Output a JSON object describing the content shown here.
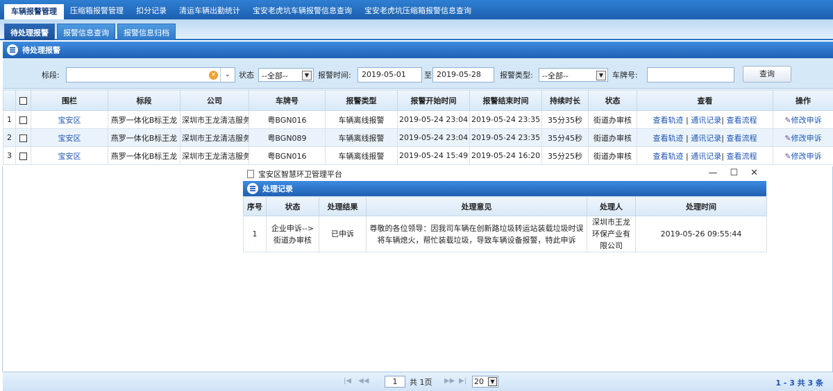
{
  "topnav": {
    "items": [
      "车辆报警管理",
      "压缩箱报警管理",
      "扣分记录",
      "清运车辆出勤统计",
      "宝安老虎坑车辆报警信息查询",
      "宝安老虎坑压缩箱报警信息查询"
    ]
  },
  "subtabs": [
    "待处理报警",
    "报警信息查询",
    "报警信息归档"
  ],
  "panel": {
    "title": "待处理报警"
  },
  "filters": {
    "segment_label": "标段:",
    "segment_value": "",
    "status_label": "状态",
    "status_value": "--全部--",
    "alarm_time_label": "报警时间:",
    "date_from": "2019-05-01",
    "to_label": "至",
    "date_to": "2019-05-28",
    "alarm_type_label": "报警类型:",
    "alarm_type_value": "--全部--",
    "plate_label": "车牌号:",
    "plate_value": "",
    "query_label": "查询"
  },
  "grid": {
    "headers": [
      "围栏",
      "标段",
      "公司",
      "车牌号",
      "报警类型",
      "报警开始时间",
      "报警结束时间",
      "持续时长",
      "状态",
      "查看",
      "操作"
    ],
    "rows": [
      {
        "no": "1",
        "fence": "宝安区",
        "segment": "燕罗一体化B标王龙",
        "company": "深圳市王龙清洁服务有",
        "plate": "粤BGN016",
        "type": "车辆离线报警",
        "start": "2019-05-24 23:04",
        "end": "2019-05-24 23:35",
        "duration": "35分35秒",
        "status": "街道办审核"
      },
      {
        "no": "2",
        "fence": "宝安区",
        "segment": "燕罗一体化B标王龙",
        "company": "深圳市王龙清洁服务有",
        "plate": "粤BGN089",
        "type": "车辆离线报警",
        "start": "2019-05-24 23:04",
        "end": "2019-05-24 23:35",
        "duration": "35分45秒",
        "status": "街道办审核"
      },
      {
        "no": "3",
        "fence": "宝安区",
        "segment": "燕罗一体化B标王龙",
        "company": "深圳市王龙清洁服务有",
        "plate": "粤BGN016",
        "type": "车辆离线报警",
        "start": "2019-05-24 15:49",
        "end": "2019-05-24 16:20",
        "duration": "35分25秒",
        "status": "街道办审核"
      }
    ],
    "view_links": [
      "查看轨迹",
      "通讯记录",
      "查看流程"
    ],
    "action_label": "修改申诉"
  },
  "popup": {
    "window_title": "宝安区智慧环卫管理平台",
    "panel_title": "处理记录",
    "headers": [
      "序号",
      "状态",
      "处理结果",
      "处理意见",
      "处理人",
      "处理时间"
    ],
    "row": {
      "no": "1",
      "status": "企业申诉-->街道办审核",
      "result": "已申诉",
      "opinion": "尊敬的各位领导：因我司车辆在创新路垃圾转运站装载垃圾时误将车辆熄火，帮忙装载垃圾，导致车辆设备报警，特此申诉",
      "handler": "深圳市王龙环保产业有限公司",
      "time": "2019-05-26 09:55:44"
    }
  },
  "pager": {
    "page": "1",
    "total_pages": "共 1页",
    "page_size": "20",
    "summary": "1 - 3  共 3 条"
  },
  "colors": {
    "accent": "#1f60b3",
    "link": "#1c54b6",
    "row_alt": "#eaf3fb"
  }
}
